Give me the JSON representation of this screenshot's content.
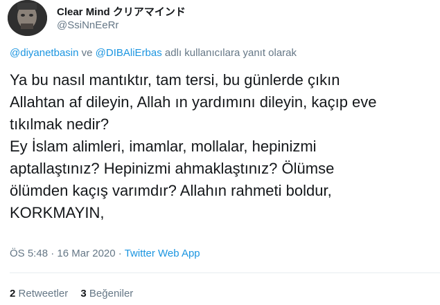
{
  "user": {
    "display_name": "Clear Mind クリアマインド",
    "handle": "@SsiNnEeRr"
  },
  "reply": {
    "mention_1": "@diyanetbasin",
    "joiner": "ve",
    "mention_2": "@DIBAliErbas",
    "suffix": "adlı kullanıcılara yanıt olarak"
  },
  "tweet": {
    "lines": [
      "Ya bu nasıl mantıktır, tam tersi, bu günlerde çıkın",
      "Allahtan af dileyin, Allah ın yardımını dileyin, kaçıp eve",
      "tıkılmak nedir?",
      "Ey İslam alimleri, imamlar, mollalar, hepinizmi",
      "aptallaştınız? Hepinizmi ahmaklaştınız? Ölümse",
      "ölümden kaçış varımdır? Allahın rahmeti boldur,",
      "KORKMAYIN,"
    ]
  },
  "meta": {
    "time": "ÖS 5:48",
    "separator": "·",
    "date": "16 Mar 2020",
    "source": "Twitter Web App"
  },
  "stats": {
    "retweets_count": "2",
    "retweets_label": "Retweetler",
    "likes_count": "3",
    "likes_label": "Beğeniler"
  },
  "colors": {
    "accent": "#1b95e0",
    "secondary_text": "#657786",
    "primary_text": "#14171a",
    "divider": "#e6ecf0"
  }
}
